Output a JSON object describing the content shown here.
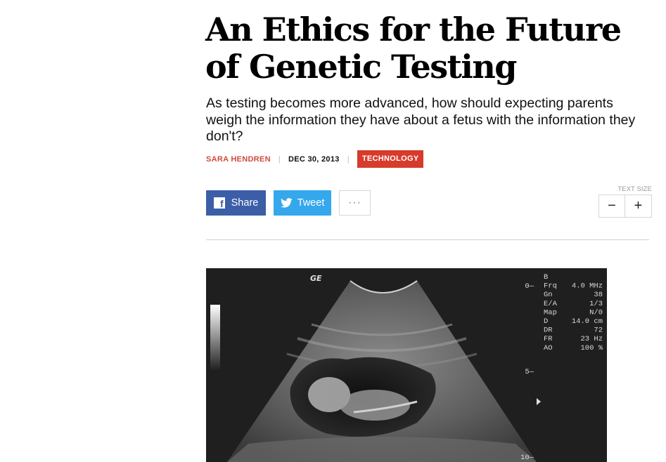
{
  "article": {
    "headline": "An Ethics for the Future of Genetic Testing",
    "dek": "As testing becomes more advanced, how should expecting parents weigh the information they have about a fetus with the information they don't?",
    "author": "SARA HENDREN",
    "date": "DEC 30, 2013",
    "section": "TECHNOLOGY"
  },
  "share": {
    "facebook_label": "Share",
    "twitter_label": "Tweet",
    "more_label": "···"
  },
  "text_size": {
    "label": "TEXT SIZE",
    "decrease_label": "−",
    "increase_label": "+"
  },
  "ultrasound": {
    "logo": "GE",
    "readout_rows": [
      {
        "key": "B",
        "value": ""
      },
      {
        "key": "Frq",
        "value": "4.0 MHz"
      },
      {
        "key": "Gn",
        "value": "38"
      },
      {
        "key": "E/A",
        "value": "1/3"
      },
      {
        "key": "Map",
        "value": "N/0"
      },
      {
        "key": "D",
        "value": "14.0 cm"
      },
      {
        "key": "DR",
        "value": "72"
      },
      {
        "key": "FR",
        "value": "23 Hz"
      },
      {
        "key": "AO",
        "value": "100 %"
      }
    ],
    "scale_marks": [
      "0",
      "5",
      "10"
    ]
  },
  "colors": {
    "author": "#cf4b3c",
    "section_tag": "#d63b2b",
    "facebook": "#3b5ea7",
    "twitter": "#35a7ec"
  }
}
